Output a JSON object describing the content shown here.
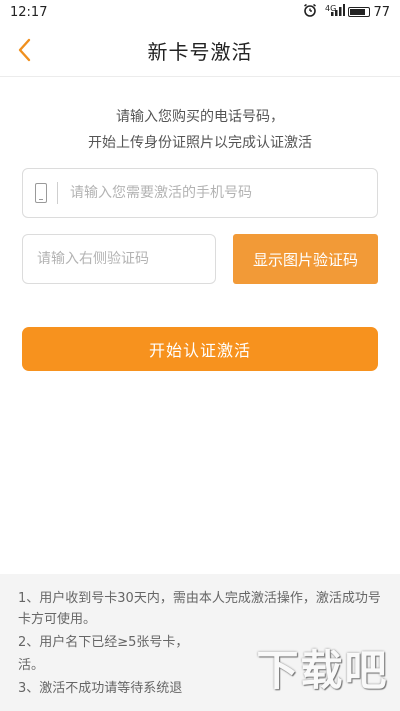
{
  "status_bar": {
    "time": "12:17",
    "signal": "4G",
    "battery": "77"
  },
  "nav": {
    "back_glyph": "‹",
    "title": "新卡号激活"
  },
  "intro": {
    "line1": "请输入您购买的电话号码，",
    "line2": "开始上传身份证照片以完成认证激活"
  },
  "phone_field": {
    "placeholder": "请输入您需要激活的手机号码",
    "value": ""
  },
  "captcha": {
    "placeholder": "请输入右侧验证码",
    "value": "",
    "button_label": "显示图片验证码"
  },
  "activate_button": {
    "label": "开始认证激活"
  },
  "notes": [
    "1、用户收到号卡30天内，需由本人完成激活操作，激活成功号卡方可使用。",
    "2、用户名下已经≥5张号卡，",
    "活。",
    "3、激活不成功请等待系统退"
  ],
  "watermark": {
    "text": "下载吧"
  },
  "colors": {
    "accent": "#f7921e",
    "captcha_button": "#f29a37",
    "notes_bg": "#f4f4f4"
  }
}
